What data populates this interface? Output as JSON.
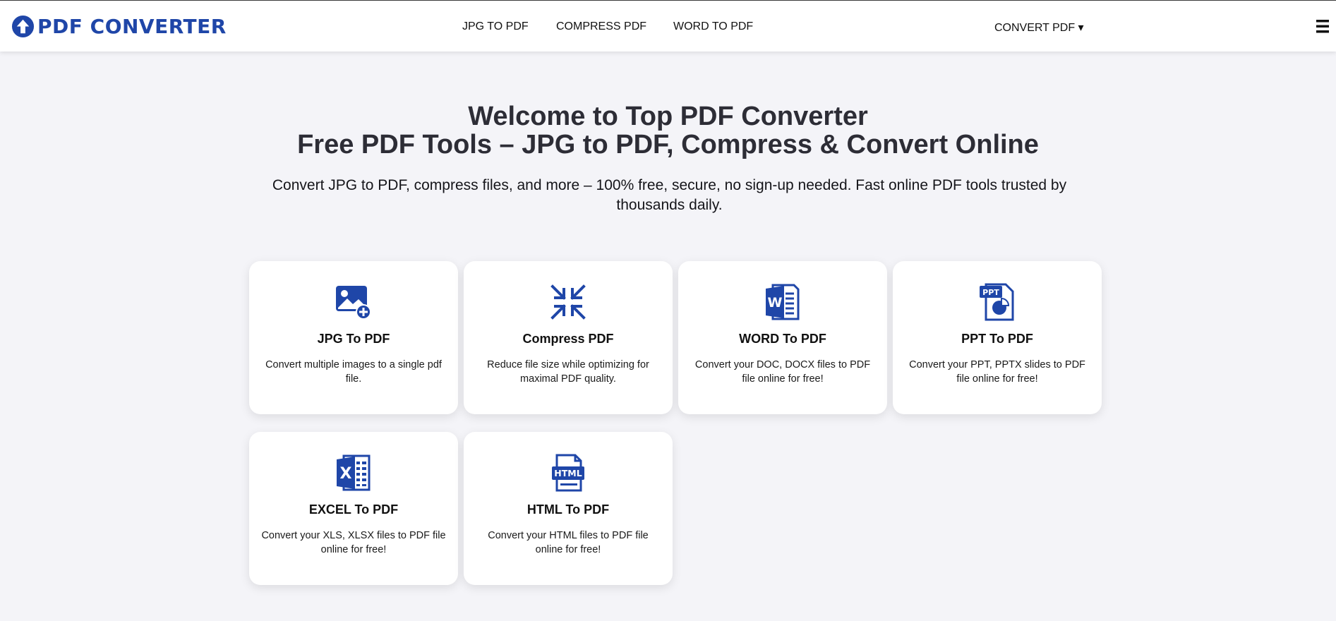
{
  "header": {
    "logo_text": "PDF CONVERTER",
    "nav": [
      {
        "label": "JPG TO PDF"
      },
      {
        "label": "COMPRESS PDF"
      },
      {
        "label": "WORD TO PDF"
      }
    ],
    "convert_dropdown": "CONVERT PDF ▾",
    "menu_icon": "hamburger-icon"
  },
  "hero": {
    "title_line1": "Welcome to Top PDF Converter",
    "title_line2": "Free PDF Tools – JPG to PDF, Compress & Convert Online",
    "subtitle": "Convert JPG to PDF, compress files, and more – 100% free, secure, no sign-up needed. Fast online PDF tools trusted by thousands daily."
  },
  "tools": [
    {
      "icon": "image-add-icon",
      "title": "JPG To PDF",
      "desc": "Convert multiple images to a single pdf file."
    },
    {
      "icon": "compress-icon",
      "title": "Compress PDF",
      "desc": "Reduce file size while optimizing for maximal PDF quality."
    },
    {
      "icon": "word-doc-icon",
      "title": "WORD To PDF",
      "desc": "Convert your DOC, DOCX files to PDF file online for free!"
    },
    {
      "icon": "ppt-file-icon",
      "title": "PPT To PDF",
      "desc": "Convert your PPT, PPTX slides to PDF file online for free!"
    },
    {
      "icon": "excel-file-icon",
      "title": "EXCEL To PDF",
      "desc": "Convert your XLS, XLSX files to PDF file online for free!"
    },
    {
      "icon": "html-file-icon",
      "title": "HTML To PDF",
      "desc": "Convert your HTML files to PDF file online for free!"
    }
  ],
  "colors": {
    "brand": "#1f46a8",
    "background": "#f4f4f8",
    "card": "#ffffff"
  }
}
